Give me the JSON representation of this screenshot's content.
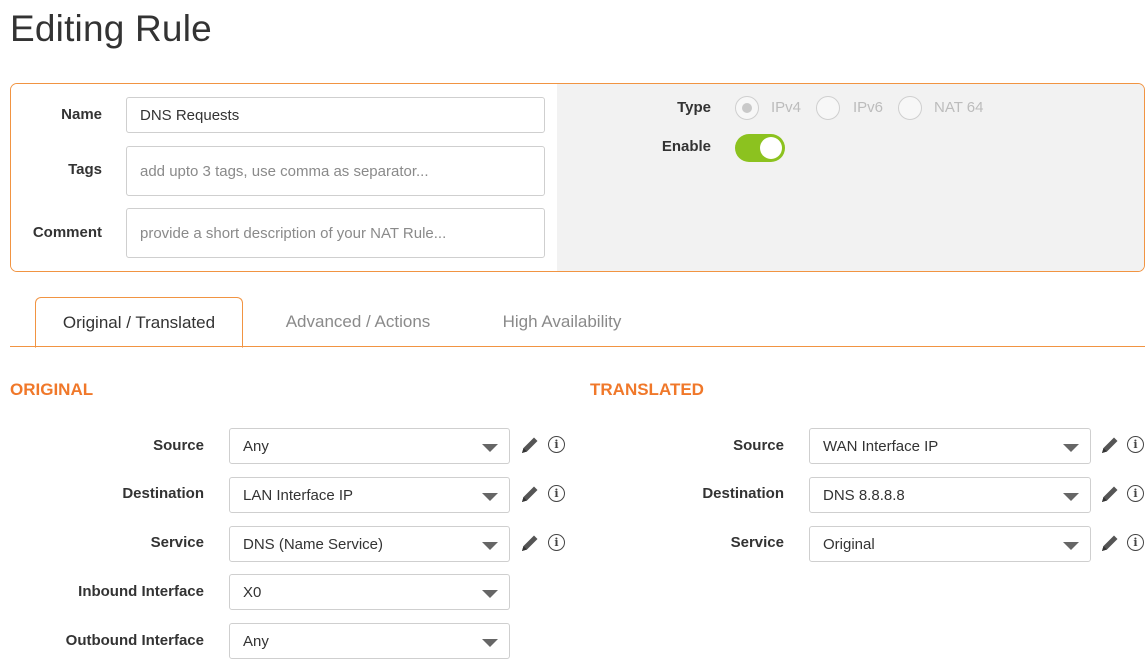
{
  "page": {
    "title": "Editing Rule"
  },
  "general": {
    "name_label": "Name",
    "name_value": "DNS Requests",
    "tags_label": "Tags",
    "tags_placeholder": "add upto 3 tags, use comma as separator...",
    "comment_label": "Comment",
    "comment_placeholder": "provide a short description of your NAT Rule...",
    "type_label": "Type",
    "type_options": [
      {
        "label": "IPv4",
        "selected": true
      },
      {
        "label": "IPv6",
        "selected": false
      },
      {
        "label": "NAT 64",
        "selected": false
      }
    ],
    "enable_label": "Enable",
    "enabled": true
  },
  "tabs": [
    {
      "label": "Original / Translated",
      "active": true
    },
    {
      "label": "Advanced / Actions",
      "active": false
    },
    {
      "label": "High Availability",
      "active": false
    }
  ],
  "original": {
    "title": "ORIGINAL",
    "rows": [
      {
        "label": "Source",
        "value": "Any"
      },
      {
        "label": "Destination",
        "value": "LAN Interface IP"
      },
      {
        "label": "Service",
        "value": "DNS (Name Service)"
      },
      {
        "label": "Inbound Interface",
        "value": "X0"
      },
      {
        "label": "Outbound Interface",
        "value": "Any"
      }
    ]
  },
  "translated": {
    "title": "TRANSLATED",
    "rows": [
      {
        "label": "Source",
        "value": "WAN Interface IP"
      },
      {
        "label": "Destination",
        "value": "DNS 8.8.8.8"
      },
      {
        "label": "Service",
        "value": "Original"
      }
    ]
  },
  "colors": {
    "accent": "#f19442",
    "section_title": "#f0782a",
    "toggle_on": "#8cc21f",
    "panel_grey": "#f2f2f2"
  },
  "icons": {
    "edit": "pencil-icon",
    "info": "info-icon",
    "dropdown": "caret-down-icon"
  },
  "info_glyph": "i"
}
